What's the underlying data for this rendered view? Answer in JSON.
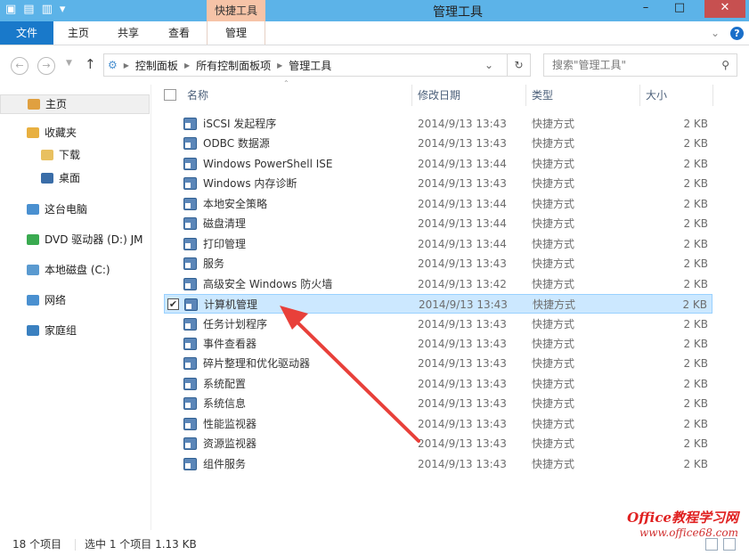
{
  "window": {
    "title": "管理工具",
    "context_tab": "快捷工具",
    "minimize": "–",
    "maximize": "□",
    "close": "✕"
  },
  "ribbon": {
    "tabs": [
      "文件",
      "主页",
      "共享",
      "查看",
      "管理"
    ],
    "help": "?",
    "expand": "⌄"
  },
  "address": {
    "crumbs": [
      "控制面板",
      "所有控制面板项",
      "管理工具"
    ],
    "search_placeholder": "搜索\"管理工具\""
  },
  "nav": [
    {
      "label": "主页",
      "icon": "home-icon",
      "color": "#e0a040"
    },
    {
      "label": "收藏夹",
      "icon": "star-icon",
      "color": "#e8b040"
    },
    {
      "label": "下载",
      "icon": "downloads-folder-icon",
      "color": "#e8c060"
    },
    {
      "label": "桌面",
      "icon": "desktop-icon",
      "color": "#3a6da8"
    },
    {
      "label": "这台电脑",
      "icon": "computer-icon",
      "color": "#4a90d0"
    },
    {
      "label": "DVD 驱动器 (D:) JM",
      "icon": "dvd-icon",
      "color": "#3aaa50"
    },
    {
      "label": "本地磁盘 (C:)",
      "icon": "disk-icon",
      "color": "#5a9ad0"
    },
    {
      "label": "网络",
      "icon": "network-icon",
      "color": "#4a90d0"
    },
    {
      "label": "家庭组",
      "icon": "homegroup-icon",
      "color": "#3a80c0"
    }
  ],
  "columns": [
    "名称",
    "修改日期",
    "类型",
    "大小"
  ],
  "files": [
    {
      "name": "iSCSI 发起程序",
      "date": "2014/9/13 13:43",
      "type": "快捷方式",
      "size": "2 KB"
    },
    {
      "name": "ODBC 数据源",
      "date": "2014/9/13 13:43",
      "type": "快捷方式",
      "size": "2 KB"
    },
    {
      "name": "Windows PowerShell ISE",
      "date": "2014/9/13 13:44",
      "type": "快捷方式",
      "size": "2 KB"
    },
    {
      "name": "Windows 内存诊断",
      "date": "2014/9/13 13:43",
      "type": "快捷方式",
      "size": "2 KB"
    },
    {
      "name": "本地安全策略",
      "date": "2014/9/13 13:44",
      "type": "快捷方式",
      "size": "2 KB"
    },
    {
      "name": "磁盘清理",
      "date": "2014/9/13 13:44",
      "type": "快捷方式",
      "size": "2 KB"
    },
    {
      "name": "打印管理",
      "date": "2014/9/13 13:44",
      "type": "快捷方式",
      "size": "2 KB"
    },
    {
      "name": "服务",
      "date": "2014/9/13 13:43",
      "type": "快捷方式",
      "size": "2 KB"
    },
    {
      "name": "高级安全 Windows 防火墙",
      "date": "2014/9/13 13:42",
      "type": "快捷方式",
      "size": "2 KB"
    },
    {
      "name": "计算机管理",
      "date": "2014/9/13 13:43",
      "type": "快捷方式",
      "size": "2 KB",
      "selected": true
    },
    {
      "name": "任务计划程序",
      "date": "2014/9/13 13:43",
      "type": "快捷方式",
      "size": "2 KB"
    },
    {
      "name": "事件查看器",
      "date": "2014/9/13 13:43",
      "type": "快捷方式",
      "size": "2 KB"
    },
    {
      "name": "碎片整理和优化驱动器",
      "date": "2014/9/13 13:43",
      "type": "快捷方式",
      "size": "2 KB"
    },
    {
      "name": "系统配置",
      "date": "2014/9/13 13:43",
      "type": "快捷方式",
      "size": "2 KB"
    },
    {
      "name": "系统信息",
      "date": "2014/9/13 13:43",
      "type": "快捷方式",
      "size": "2 KB"
    },
    {
      "name": "性能监视器",
      "date": "2014/9/13 13:43",
      "type": "快捷方式",
      "size": "2 KB"
    },
    {
      "name": "资源监视器",
      "date": "2014/9/13 13:43",
      "type": "快捷方式",
      "size": "2 KB"
    },
    {
      "name": "组件服务",
      "date": "2014/9/13 13:43",
      "type": "快捷方式",
      "size": "2 KB"
    }
  ],
  "status": {
    "count": "18 个项目",
    "selection": "选中 1 个项目  1.13 KB"
  },
  "watermark": {
    "line1": "Office教程学习网",
    "line2": "www.office68.com"
  },
  "colors": {
    "accent": "#1979ca",
    "selected": "#cce8ff",
    "arrow": "#e8403a"
  }
}
